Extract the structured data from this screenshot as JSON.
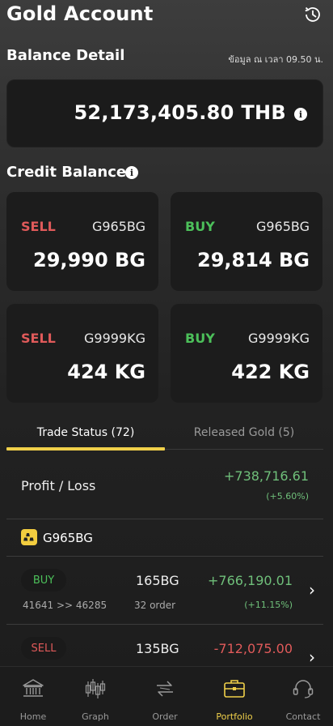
{
  "header": {
    "title": "Gold Account",
    "history_icon": "history-clock-icon"
  },
  "balance": {
    "section_title": "Balance Detail",
    "note": "ข้อมูล ณ เวลา 09.50 น.",
    "value": "52,173,405.80 THB",
    "info_icon": "i"
  },
  "credit": {
    "section_title": "Credit Balance",
    "info_icon": "i",
    "cards": [
      {
        "side": "SELL",
        "code": "G965BG",
        "amount": "29,990 BG"
      },
      {
        "side": "BUY",
        "code": "G965BG",
        "amount": "29,814 BG"
      },
      {
        "side": "SELL",
        "code": "G9999KG",
        "amount": "424 KG"
      },
      {
        "side": "BUY",
        "code": "G9999KG",
        "amount": "422 KG"
      }
    ]
  },
  "tabs": {
    "active": "Trade Status (72)",
    "inactive": "Released Gold (5)"
  },
  "profit_loss": {
    "label": "Profit / Loss",
    "value": "+738,716.61",
    "percent": "(+5.60%)"
  },
  "group": {
    "code": "G965BG",
    "rows": [
      {
        "side": "BUY",
        "range": "41641 >> 46285",
        "amount": "165BG",
        "orders": "32 order",
        "value": "+766,190.01",
        "percent": "(+11.15%)"
      },
      {
        "side": "SELL",
        "amount": "135BG",
        "value": "-712,075.00"
      }
    ]
  },
  "nav": {
    "items": [
      {
        "label": "Home",
        "icon": "bank-icon"
      },
      {
        "label": "Graph",
        "icon": "candlestick-icon"
      },
      {
        "label": "Order",
        "icon": "exchange-icon"
      },
      {
        "label": "Portfolio",
        "icon": "briefcase-icon"
      },
      {
        "label": "Contact",
        "icon": "headset-icon"
      }
    ],
    "active_index": 3
  },
  "colors": {
    "accent": "#f0d04a",
    "buy": "#4cc05a",
    "sell": "#e05a5a",
    "profit": "#6fbf7a"
  }
}
